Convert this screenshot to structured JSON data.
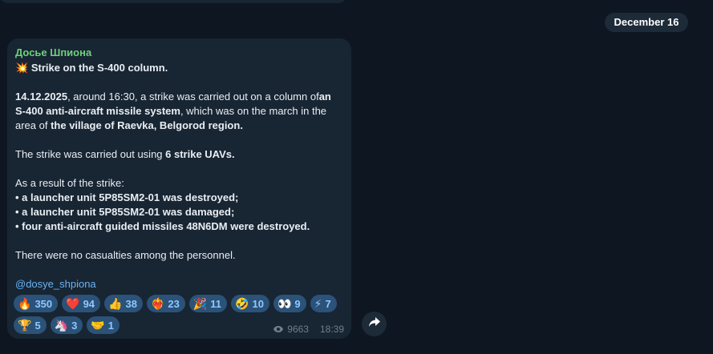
{
  "date_separator": "December 16",
  "message": {
    "sender": "Досье Шпиона",
    "title_emoji": "💥",
    "title": "Strike on the S-400 column.",
    "p1": {
      "date": "14.12.2025",
      "text1": ", around 16:30, a strike was carried out on a column of",
      "bold1": "an S-400 anti-aircraft missile system",
      "text2": ", which was on the march in the area of ",
      "bold2": "the village of Raevka, Belgorod region."
    },
    "p2": {
      "text": "The strike was carried out using ",
      "bold": "6 strike UAVs."
    },
    "p3_intro": "As a result of the strike:",
    "bullets": [
      "• a launcher unit 5P85SM2-01 was destroyed;",
      "• a launcher unit 5P85SM2-01 was damaged;",
      "• four anti-aircraft guided missiles 48N6DM were destroyed."
    ],
    "p4": "There were no casualties among the personnel.",
    "channel_link": "@dosye_shpiona",
    "views": "9663",
    "time": "18:39"
  },
  "reactions": [
    {
      "emoji": "🔥",
      "count": "350"
    },
    {
      "emoji": "❤️",
      "count": "94"
    },
    {
      "emoji": "👍",
      "count": "38"
    },
    {
      "emoji": "❤️‍🔥",
      "count": "23"
    },
    {
      "emoji": "🎉",
      "count": "11"
    },
    {
      "emoji": "🤣",
      "count": "10"
    },
    {
      "emoji": "👀",
      "count": "9"
    },
    {
      "emoji": "⚡",
      "count": "7"
    },
    {
      "emoji": "🏆",
      "count": "5"
    },
    {
      "emoji": "🦄",
      "count": "3"
    },
    {
      "emoji": "🤝",
      "count": "1"
    }
  ],
  "icons": {
    "views": "eye-icon",
    "share": "share-arrow-icon"
  }
}
